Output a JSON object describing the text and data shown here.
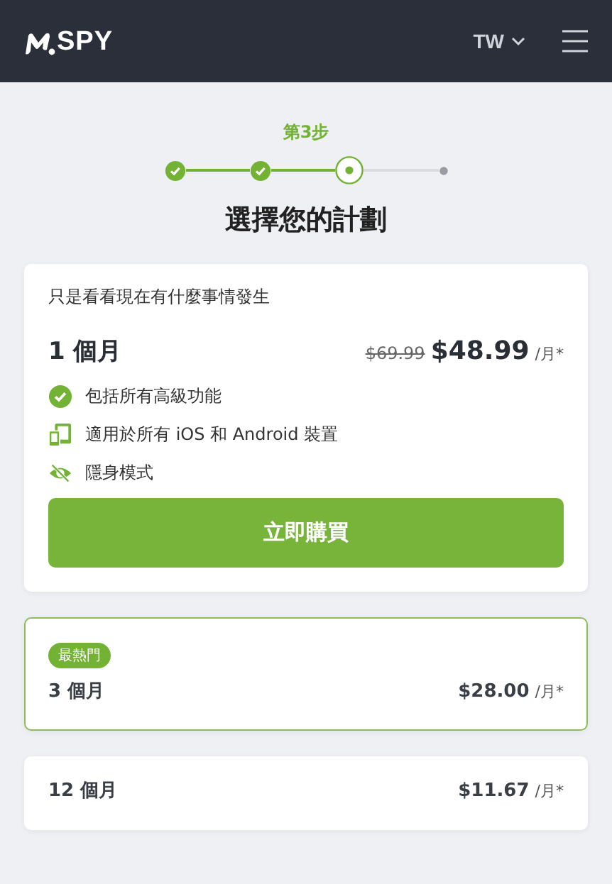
{
  "header": {
    "logo": "SPY",
    "language": "TW"
  },
  "steps": {
    "label": "第3步",
    "items": [
      {
        "kind": "done"
      },
      {
        "kind": "done"
      },
      {
        "kind": "current"
      },
      {
        "kind": "pending"
      }
    ]
  },
  "title": "選擇您的計劃",
  "plans": [
    {
      "expanded": true,
      "highlighted": false,
      "subtitle": "只是看看現在有什麼事情發生",
      "name": "1 個月",
      "old_price": "$69.99",
      "price": "$48.99",
      "per": "/月*",
      "features": [
        {
          "kind": "check",
          "text": "包括所有高級功能"
        },
        {
          "kind": "devices",
          "text": "適用於所有 iOS 和 Android 裝置"
        },
        {
          "kind": "hidden",
          "text": "隱身模式"
        }
      ],
      "button": "立即購買"
    },
    {
      "expanded": false,
      "highlighted": true,
      "badge": "最熱門",
      "name": "3 個月",
      "price": "$28.00",
      "per": "/月*"
    },
    {
      "expanded": false,
      "highlighted": false,
      "name": "12 個月",
      "price": "$11.67",
      "per": "/月*"
    }
  ]
}
